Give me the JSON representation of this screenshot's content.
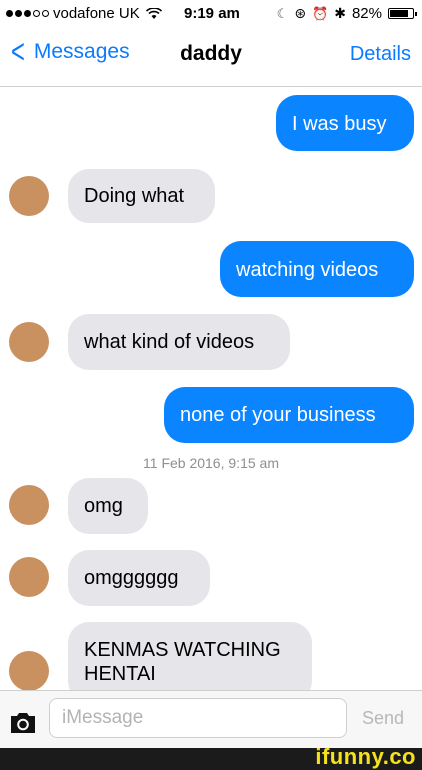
{
  "status_bar": {
    "carrier": "vodafone UK",
    "time": "9:19 am",
    "battery": "82%",
    "battery_level": 0.82
  },
  "nav": {
    "back_label": "Messages",
    "contact_name": "daddy",
    "details_label": "Details"
  },
  "messages": [
    {
      "sender": "me",
      "text": "I was busy"
    },
    {
      "sender": "them",
      "text": "Doing what"
    },
    {
      "sender": "me",
      "text": "watching videos"
    },
    {
      "sender": "them",
      "text": "what kind of videos"
    },
    {
      "sender": "me",
      "text": "none of your business"
    },
    {
      "sender": "them",
      "text": "omg"
    },
    {
      "sender": "them",
      "text": "omgggggg"
    },
    {
      "sender": "them",
      "text": "KENMAS WATCHING HENTAI"
    }
  ],
  "timestamp": {
    "date": "11 Feb 2016,",
    "time": "9:15 am"
  },
  "input": {
    "placeholder": "iMessage",
    "send_label": "Send"
  },
  "watermark": "ifunny.co",
  "colors": {
    "accent": "#0a84ff",
    "incoming_bubble": "#e5e5ea",
    "watermark": "#f6e21a"
  }
}
